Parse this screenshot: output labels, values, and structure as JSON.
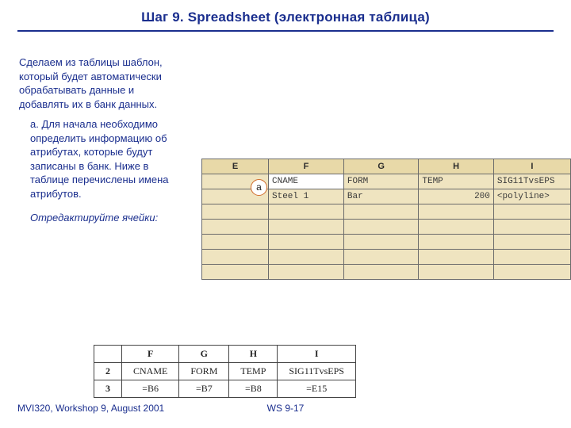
{
  "title": "Шаг 9.  Spreadsheet (электронная таблица)",
  "left": {
    "lead": "Сделаем из таблицы шаблон, который будет автоматически обрабатывать данные и добавлять их в банк данных.",
    "a_label": "a.",
    "a_body": "Для начала необходимо определить информацию об атрибутах, которые будут записаны в банк. Ниже в таблице перечислены имена атрибутов.",
    "edit_note": "Отредактируйте ячейки:"
  },
  "annotation_label": "a",
  "sheet": {
    "cols": [
      "E",
      "F",
      "G",
      "H",
      "I"
    ],
    "row1": [
      "",
      "CNAME",
      "FORM",
      "TEMP",
      "SIG11TvsEPS"
    ],
    "row2": [
      "",
      "Steel 1",
      "Bar",
      "200",
      "<polyline>"
    ]
  },
  "ftable": {
    "cols": [
      "",
      "F",
      "G",
      "H",
      "I"
    ],
    "r2": [
      "2",
      "CNAME",
      "FORM",
      "TEMP",
      "SIG11TvsEPS"
    ],
    "r3": [
      "3",
      "=B6",
      "=B7",
      "=B8",
      "=E15"
    ]
  },
  "footer": {
    "left": "MVI320, Workshop 9, August 2001",
    "center": "WS 9-17"
  }
}
